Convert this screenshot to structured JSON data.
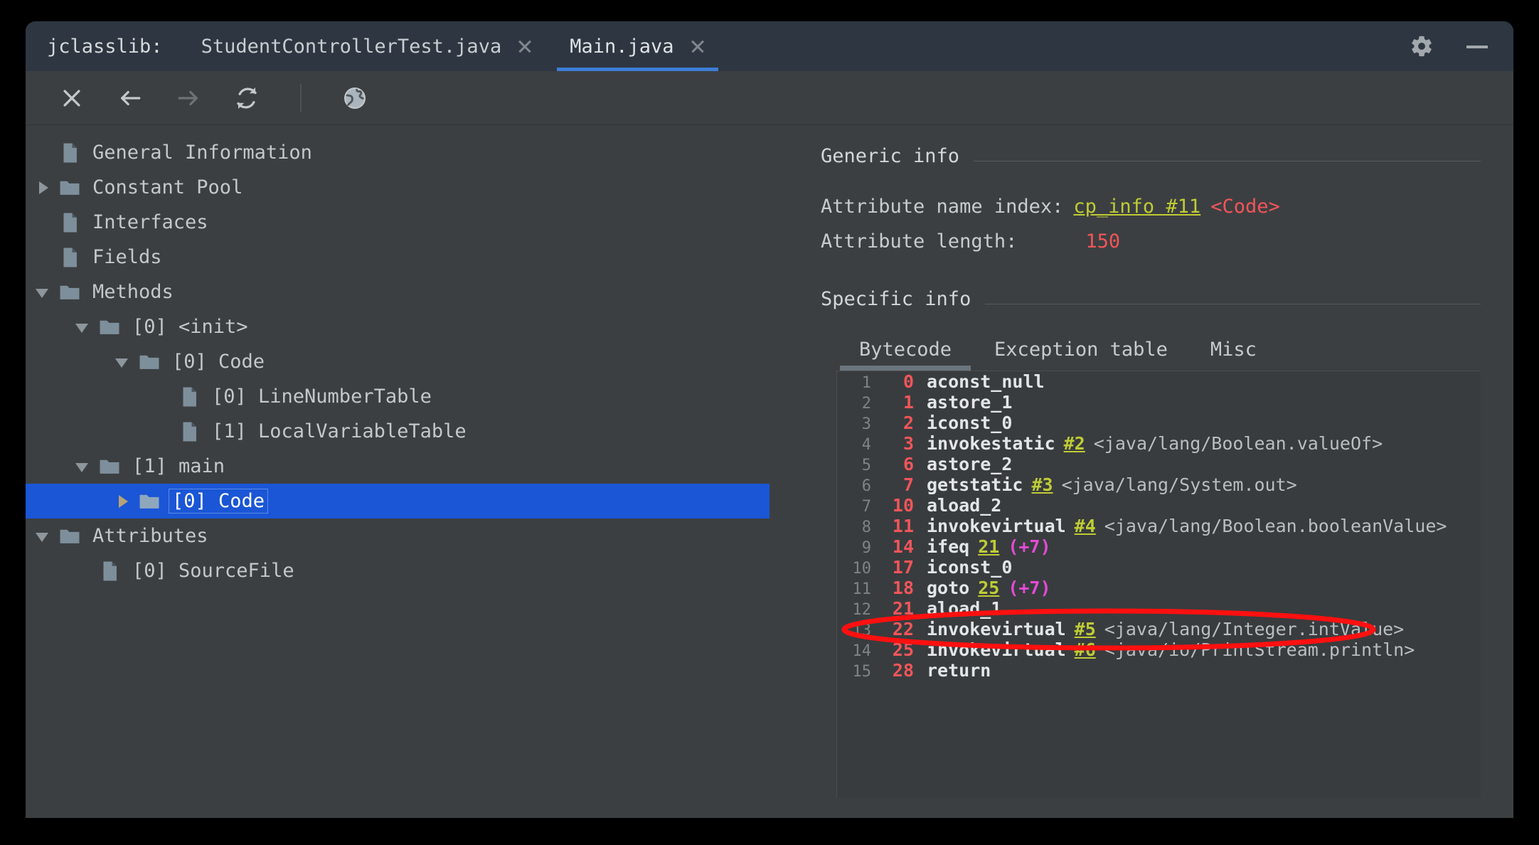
{
  "window": {
    "app_label": "jclasslib:",
    "tabs": [
      {
        "label": "StudentControllerTest.java",
        "active": false,
        "closable": true
      },
      {
        "label": "Main.java",
        "active": true,
        "closable": true
      }
    ],
    "controls": [
      {
        "name": "settings-icon",
        "label": "Settings"
      },
      {
        "name": "minimize-icon",
        "label": "Minimize"
      }
    ]
  },
  "toolbar": {
    "buttons": [
      {
        "name": "close-button",
        "label": "Close",
        "enabled": true
      },
      {
        "name": "back-button",
        "label": "Back",
        "enabled": true
      },
      {
        "name": "forward-button",
        "label": "Forward",
        "enabled": false
      },
      {
        "name": "reload-button",
        "label": "Reload",
        "enabled": true
      },
      {
        "name": "browse-button",
        "label": "Browse classpath",
        "enabled": true
      }
    ]
  },
  "tree": [
    {
      "label": "General Information",
      "indent": 1,
      "icon": "file",
      "twisty": "none",
      "selected": false
    },
    {
      "label": "Constant Pool",
      "indent": 1,
      "icon": "folder",
      "twisty": "closed",
      "selected": false
    },
    {
      "label": "Interfaces",
      "indent": 1,
      "icon": "file",
      "twisty": "none",
      "selected": false
    },
    {
      "label": "Fields",
      "indent": 1,
      "icon": "file",
      "twisty": "none",
      "selected": false
    },
    {
      "label": "Methods",
      "indent": 1,
      "icon": "folder",
      "twisty": "open",
      "selected": false
    },
    {
      "label": "[0] <init>",
      "indent": 2,
      "icon": "folder",
      "twisty": "open",
      "selected": false
    },
    {
      "label": "[0] Code",
      "indent": 3,
      "icon": "folder",
      "twisty": "open",
      "selected": false
    },
    {
      "label": "[0] LineNumberTable",
      "indent": 4,
      "icon": "file",
      "twisty": "none",
      "selected": false
    },
    {
      "label": "[1] LocalVariableTable",
      "indent": 4,
      "icon": "file",
      "twisty": "none",
      "selected": false
    },
    {
      "label": "[1] main",
      "indent": 2,
      "icon": "folder",
      "twisty": "open",
      "selected": false
    },
    {
      "label": "[0] Code",
      "indent": 3,
      "icon": "folder",
      "twisty": "closed",
      "selected": true
    },
    {
      "label": "Attributes",
      "indent": 1,
      "icon": "folder",
      "twisty": "open",
      "selected": false
    },
    {
      "label": "[0] SourceFile",
      "indent": 2,
      "icon": "file",
      "twisty": "none",
      "selected": false
    }
  ],
  "detail": {
    "generic_info_title": "Generic info",
    "attribute_name_index_label": "Attribute name index:",
    "attribute_name_index_link": "cp_info #11",
    "attribute_name_index_value": "<Code>",
    "attribute_length_label": "Attribute length:",
    "attribute_length_value": "150",
    "specific_info_title": "Specific info",
    "tabs": [
      {
        "label": "Bytecode",
        "active": true
      },
      {
        "label": "Exception table",
        "active": false
      },
      {
        "label": "Misc",
        "active": false
      }
    ]
  },
  "bytecode": {
    "lines": [
      {
        "n": "1",
        "offset": "0",
        "op": "aconst_null",
        "ref": "",
        "comment": "",
        "delta": ""
      },
      {
        "n": "2",
        "offset": "1",
        "op": "astore_1",
        "ref": "",
        "comment": "",
        "delta": ""
      },
      {
        "n": "3",
        "offset": "2",
        "op": "iconst_0",
        "ref": "",
        "comment": "",
        "delta": ""
      },
      {
        "n": "4",
        "offset": "3",
        "op": "invokestatic",
        "ref": "#2",
        "comment": "<java/lang/Boolean.valueOf>",
        "delta": ""
      },
      {
        "n": "5",
        "offset": "6",
        "op": "astore_2",
        "ref": "",
        "comment": "",
        "delta": ""
      },
      {
        "n": "6",
        "offset": "7",
        "op": "getstatic",
        "ref": "#3",
        "comment": "<java/lang/System.out>",
        "delta": ""
      },
      {
        "n": "7",
        "offset": "10",
        "op": "aload_2",
        "ref": "",
        "comment": "",
        "delta": ""
      },
      {
        "n": "8",
        "offset": "11",
        "op": "invokevirtual",
        "ref": "#4",
        "comment": "<java/lang/Boolean.booleanValue>",
        "delta": ""
      },
      {
        "n": "9",
        "offset": "14",
        "op": "ifeq",
        "ref": "21",
        "comment": "",
        "delta": "(+7)"
      },
      {
        "n": "10",
        "offset": "17",
        "op": "iconst_0",
        "ref": "",
        "comment": "",
        "delta": ""
      },
      {
        "n": "11",
        "offset": "18",
        "op": "goto",
        "ref": "25",
        "comment": "",
        "delta": "(+7)"
      },
      {
        "n": "12",
        "offset": "21",
        "op": "aload_1",
        "ref": "",
        "comment": "",
        "delta": ""
      },
      {
        "n": "13",
        "offset": "22",
        "op": "invokevirtual",
        "ref": "#5",
        "comment": "<java/lang/Integer.intValue>",
        "delta": ""
      },
      {
        "n": "14",
        "offset": "25",
        "op": "invokevirtual",
        "ref": "#6",
        "comment": "<java/io/PrintStream.println>",
        "delta": ""
      },
      {
        "n": "15",
        "offset": "28",
        "op": "return",
        "ref": "",
        "comment": "",
        "delta": ""
      }
    ],
    "annotation": {
      "type": "ellipse",
      "color": "#ff1010",
      "target_line_index": 12
    }
  },
  "colors": {
    "window_bg": "#3c3f41",
    "titlebar_bg": "#2e3741",
    "active_tab_underline": "#3d7dd4",
    "tree_selection": "#1a56d6",
    "link": "#bfcc35",
    "value_red": "#f2555a",
    "branch_delta": "#e44bd8",
    "annotation_red": "#ff1010"
  }
}
